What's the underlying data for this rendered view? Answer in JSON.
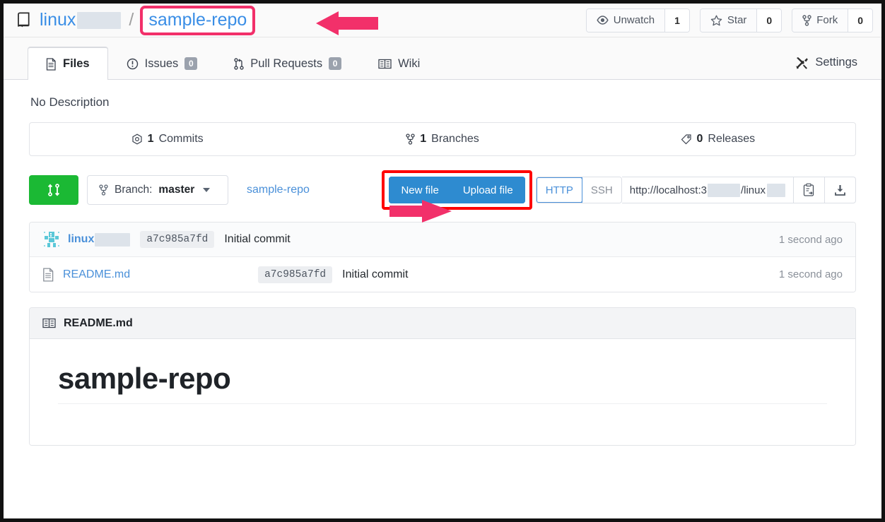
{
  "header": {
    "repo_icon": "repo-book-icon",
    "owner": "linux",
    "owner_redacted": true,
    "separator": "/",
    "repo_name": "sample-repo",
    "actions": [
      {
        "icon": "eye-icon",
        "label": "Unwatch",
        "count": "1"
      },
      {
        "icon": "star-icon",
        "label": "Star",
        "count": "0"
      },
      {
        "icon": "fork-icon",
        "label": "Fork",
        "count": "0"
      }
    ]
  },
  "tabs": [
    {
      "icon": "file-icon",
      "label": "Files",
      "badge": null,
      "active": true
    },
    {
      "icon": "issue-opened-icon",
      "label": "Issues",
      "badge": "0",
      "active": false
    },
    {
      "icon": "git-pull-request-icon",
      "label": "Pull Requests",
      "badge": "0",
      "active": false
    },
    {
      "icon": "book-icon",
      "label": "Wiki",
      "badge": null,
      "active": false
    }
  ],
  "settings_tab": {
    "icon": "tools-icon",
    "label": "Settings"
  },
  "description": "No Description",
  "stats": [
    {
      "icon": "clock-icon",
      "count": "1",
      "label": "Commits"
    },
    {
      "icon": "branch-icon",
      "count": "1",
      "label": "Branches"
    },
    {
      "icon": "tag-icon",
      "count": "0",
      "label": "Releases"
    }
  ],
  "toolbar": {
    "sync_button_icon": "sync-icon",
    "branch_prefix": "Branch:",
    "branch_name": "master",
    "path_label": "sample-repo",
    "new_file_label": "New file",
    "upload_file_label": "Upload file",
    "protocols": [
      {
        "label": "HTTP",
        "active": true
      },
      {
        "label": "SSH",
        "active": false
      }
    ],
    "clone_url_prefix": "http://localhost:3",
    "clone_url_middle": "/linux",
    "copy_icon": "clipboard-copy-icon",
    "download_icon": "download-icon"
  },
  "files": {
    "commit_row": {
      "avatar": "identicon-avatar",
      "author": "linux",
      "sha": "a7c985a7fd",
      "message": "Initial commit",
      "time": "1 second ago"
    },
    "rows": [
      {
        "icon": "file-text-icon",
        "name": "README.md",
        "sha": "a7c985a7fd",
        "message": "Initial commit",
        "time": "1 second ago"
      }
    ]
  },
  "readme": {
    "icon": "book-icon",
    "title": "README.md",
    "heading": "sample-repo"
  },
  "annotations": {
    "highlight_color": "#f2306a",
    "box_color": "#ff0000",
    "arrow_color": "#f2306a"
  }
}
